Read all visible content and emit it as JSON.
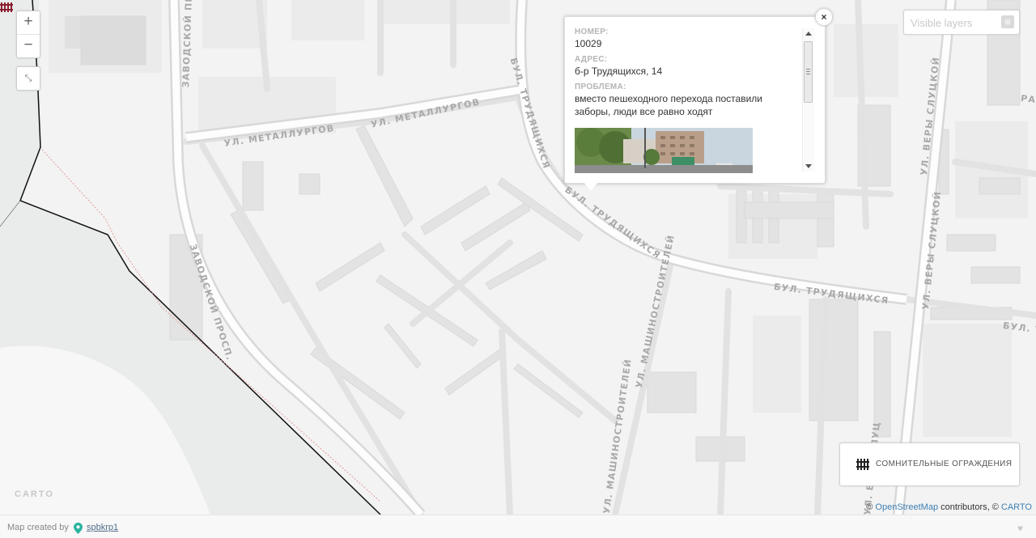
{
  "map": {
    "streets": [
      {
        "id": "metallurgov",
        "label": "УЛ. МЕТАЛЛУРГОВ"
      },
      {
        "id": "trudyaschihsya_top",
        "label": "БУЛ. ТРУДЯЩИХСЯ"
      },
      {
        "id": "trudyaschihsya_mid",
        "label": "БУЛ. ТРУДЯЩИХСЯ"
      },
      {
        "id": "trudyaschihsya_right",
        "label": "БУЛ. ТРУДЯЩИХСЯ"
      },
      {
        "id": "zavodskoy_top",
        "label": "ЗАВОДСКОЙ ПРОСП."
      },
      {
        "id": "zavodskoy_mid",
        "label": "ЗАВОДСКОЙ ПРОСП."
      },
      {
        "id": "mashinostroiteley_mid",
        "label": "УЛ. МАШИНОСТРОИТЕЛЕЙ"
      },
      {
        "id": "mashinostroiteley_bot",
        "label": "УЛ. МАШИНОСТРОИТЕЛЕЙ"
      },
      {
        "id": "very_sluckoy_top",
        "label": "УЛ. ВЕРЫ СЛУЦКОЙ"
      },
      {
        "id": "very_sluckoy_mid",
        "label": "УЛ. ВЕРЫ СЛУЦКОЙ"
      },
      {
        "id": "very_sluckoy_bot",
        "label": "УЛ. ВЕРЫ СЛУЦ"
      },
      {
        "id": "bul_right_a",
        "label": "БУЛ. Т"
      },
      {
        "id": "ra",
        "label": "РА"
      }
    ],
    "zoom_in": "+",
    "zoom_out": "−",
    "fullscreen_icon": "⤡",
    "carto_logo": "CARTO"
  },
  "layers": {
    "label": "Visible layers",
    "toggle": "⊞"
  },
  "popup": {
    "close": "×",
    "fields": [
      {
        "label": "НОМЕР:",
        "value": "10029"
      },
      {
        "label": "АДРЕС:",
        "value": "б-р Трудящихся, 14"
      },
      {
        "label": "ПРОБЛЕМА:",
        "value": "вместо пешеходного перехода поставили заборы, люди все равно ходят"
      }
    ]
  },
  "legend": {
    "label": "СОМНИТЕЛЬНЫЕ ОГРАЖДЕНИЯ",
    "color": "#7a1e2b"
  },
  "attribution": {
    "prefix": "© ",
    "osm": "OpenStreetMap",
    "mid": " contributors, © ",
    "carto": "CARTO"
  },
  "footer": {
    "created_by": "Map created by",
    "user": "spbkrp1",
    "heart": "♥"
  }
}
